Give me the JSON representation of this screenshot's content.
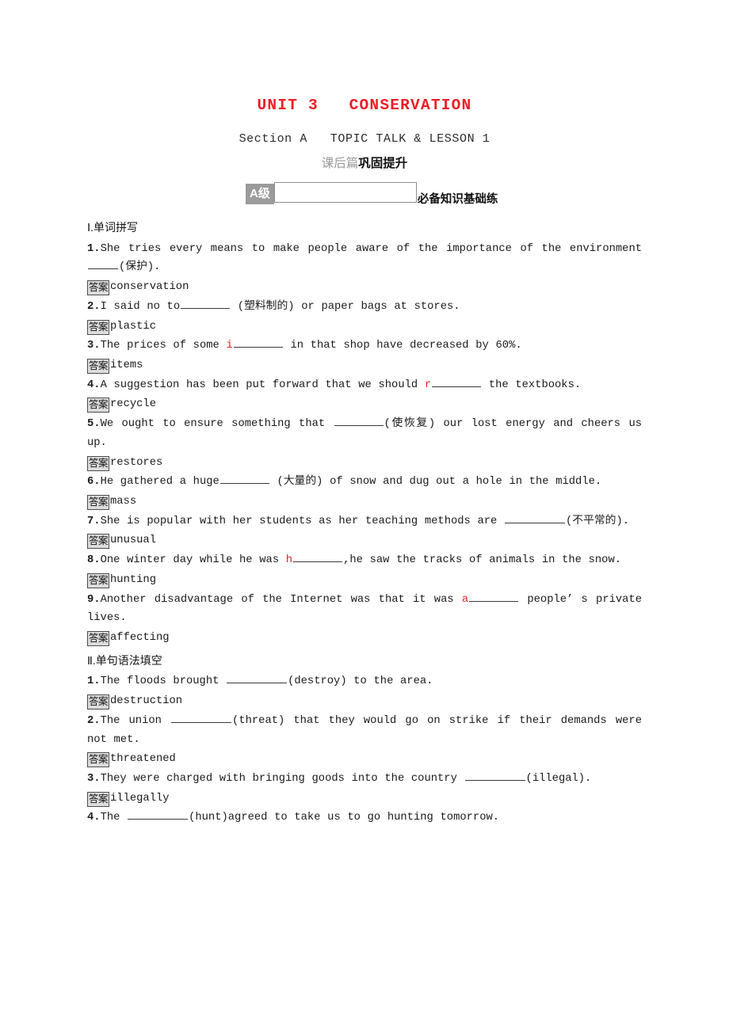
{
  "header": {
    "unit_title": "UNIT 3   CONSERVATION",
    "section_line": "Section A   TOPIC TALK & LESSON 1",
    "post_class_light": "课后篇",
    "post_class_strong": "巩固提升",
    "level_badge": "A级",
    "level_caption": "必备知识基础练",
    "accent_color": "#ef1c24",
    "badge_bg": "#9b9b9b",
    "answer_badge_bg": "#dcdcdc"
  },
  "answer_label": "答案",
  "sections": [
    {
      "heading": "Ⅰ.单词拼写",
      "items": [
        {
          "num": "1.",
          "parts": [
            {
              "t": "text",
              "v": "She tries every means to make people aware of the importance of the environment "
            },
            {
              "t": "blank",
              "w": "w-tail"
            },
            {
              "t": "text",
              "v": "(保护)."
            }
          ],
          "answer": "conservation"
        },
        {
          "num": "2.",
          "parts": [
            {
              "t": "text",
              "v": "I said no to"
            },
            {
              "t": "blank",
              "w": "w-med"
            },
            {
              "t": "text",
              "v": " (塑料制的) or paper bags at stores."
            }
          ],
          "answer": "plastic"
        },
        {
          "num": "3.",
          "parts": [
            {
              "t": "text",
              "v": "The prices of some "
            },
            {
              "t": "hint",
              "v": "i"
            },
            {
              "t": "blank",
              "w": "w-med"
            },
            {
              "t": "text",
              "v": " in that shop have decreased by 60%."
            }
          ],
          "answer": "items"
        },
        {
          "num": "4.",
          "parts": [
            {
              "t": "text",
              "v": "A suggestion has been put forward that we should "
            },
            {
              "t": "hint",
              "v": "r"
            },
            {
              "t": "blank",
              "w": "w-med"
            },
            {
              "t": "text",
              "v": " the textbooks."
            }
          ],
          "answer": "recycle"
        },
        {
          "num": "5.",
          "parts": [
            {
              "t": "text",
              "v": "We ought to ensure something that "
            },
            {
              "t": "blank",
              "w": "w-med"
            },
            {
              "t": "text",
              "v": "(使恢复) our lost energy and cheers us up."
            }
          ],
          "answer": "restores"
        },
        {
          "num": "6.",
          "parts": [
            {
              "t": "text",
              "v": "He gathered a huge"
            },
            {
              "t": "blank",
              "w": "w-med"
            },
            {
              "t": "text",
              "v": " (大量的) of snow and dug out a hole in the middle."
            }
          ],
          "answer": "mass"
        },
        {
          "num": "7.",
          "parts": [
            {
              "t": "text",
              "v": "She is popular with her students as her teaching methods are "
            },
            {
              "t": "blank",
              "w": "w-long"
            },
            {
              "t": "text",
              "v": "(不平常的)."
            }
          ],
          "answer": "unusual"
        },
        {
          "num": "8.",
          "parts": [
            {
              "t": "text",
              "v": "One winter day while he was "
            },
            {
              "t": "hint",
              "v": "h"
            },
            {
              "t": "blank",
              "w": "w-med"
            },
            {
              "t": "text",
              "v": ",he saw the tracks of animals in the snow."
            }
          ],
          "answer": "hunting"
        },
        {
          "num": "9.",
          "parts": [
            {
              "t": "text",
              "v": "Another disadvantage of the Internet was that it was "
            },
            {
              "t": "hint",
              "v": "a"
            },
            {
              "t": "blank",
              "w": "w-med"
            },
            {
              "t": "text",
              "v": " people’ s private lives."
            }
          ],
          "answer": "affecting"
        }
      ]
    },
    {
      "heading": "Ⅱ.单句语法填空",
      "items": [
        {
          "num": "1.",
          "parts": [
            {
              "t": "text",
              "v": "The floods brought "
            },
            {
              "t": "blank",
              "w": "w-long"
            },
            {
              "t": "text",
              "v": "(destroy) to the area."
            }
          ],
          "answer": "destruction"
        },
        {
          "num": "2.",
          "parts": [
            {
              "t": "text",
              "v": "The union "
            },
            {
              "t": "blank",
              "w": "w-long"
            },
            {
              "t": "text",
              "v": "(threat) that they would go on strike if their demands were not met."
            }
          ],
          "answer": "threatened"
        },
        {
          "num": "3.",
          "parts": [
            {
              "t": "text",
              "v": "They were charged with bringing goods into the country "
            },
            {
              "t": "blank",
              "w": "w-long"
            },
            {
              "t": "text",
              "v": "(illegal)."
            }
          ],
          "answer": "illegally"
        },
        {
          "num": "4.",
          "parts": [
            {
              "t": "text",
              "v": "The "
            },
            {
              "t": "blank",
              "w": "w-long"
            },
            {
              "t": "text",
              "v": "(hunt)agreed to take us to go hunting tomorrow."
            }
          ],
          "answer": null
        }
      ]
    }
  ]
}
